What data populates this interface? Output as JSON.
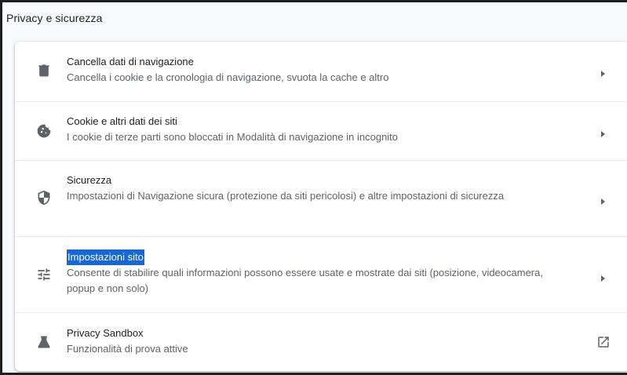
{
  "section": {
    "title": "Privacy e sicurezza"
  },
  "items": [
    {
      "label": "Cancella dati di navigazione",
      "sub": "Cancella i cookie e la cronologia di navigazione, svuota la cache e altro",
      "icon": "trash-icon",
      "action": "chevron-right-icon"
    },
    {
      "label": "Cookie e altri dati dei siti",
      "sub": "I cookie di terze parti sono bloccati in Modalità di navigazione in incognito",
      "icon": "cookie-icon",
      "action": "chevron-right-icon"
    },
    {
      "label": "Sicurezza",
      "sub": "Impostazioni di Navigazione sicura (protezione da siti pericolosi) e altre impostazioni di sicurezza",
      "icon": "shield-icon",
      "action": "chevron-right-icon"
    },
    {
      "label": "Impostazioni sito",
      "sub": "Consente di stabilire quali informazioni possono essere usate e mostrate dai siti (posizione, videocamera, popup e non solo)",
      "icon": "tune-icon",
      "action": "chevron-right-icon",
      "selected_text": true
    },
    {
      "label": "Privacy Sandbox",
      "sub": "Funzionalità di prova attive",
      "icon": "flask-icon",
      "action": "open-external-icon"
    }
  ],
  "colors": {
    "icon": "#5f6368",
    "label": "#202124",
    "sub": "#5f6368",
    "selection": "#1967d2",
    "divider": "#e8eaed",
    "page_background": "#f8f9fa"
  }
}
